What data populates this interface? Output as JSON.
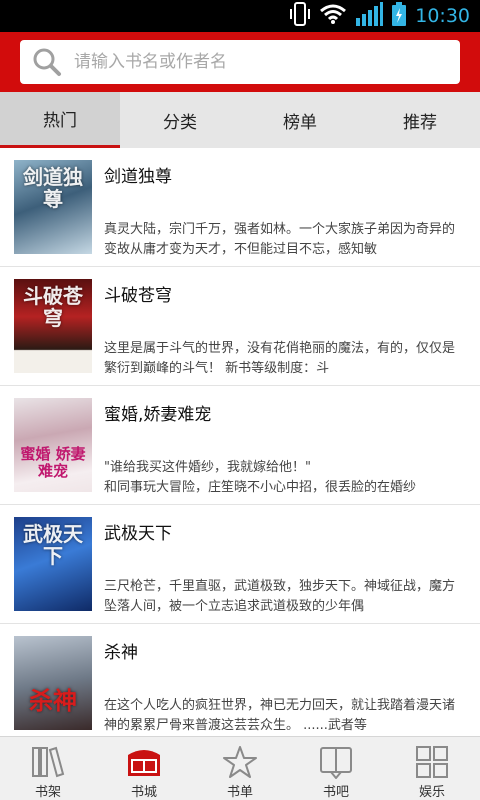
{
  "status": {
    "time": "10:30",
    "time_color": "#33b5e5"
  },
  "search": {
    "placeholder": "请输入书名或作者名",
    "bar_color": "#d20c0c"
  },
  "tabs": [
    {
      "label": "热门",
      "active": true
    },
    {
      "label": "分类",
      "active": false
    },
    {
      "label": "榜单",
      "active": false
    },
    {
      "label": "推荐",
      "active": false
    }
  ],
  "books": [
    {
      "title": "剑道独尊",
      "cover_text": "剑道独尊",
      "desc": "真灵大陆，宗门千万，强者如林。一个大家族子弟因为奇异的变故从庸才变为天才，不但能过目不忘，感知敏"
    },
    {
      "title": "斗破苍穹",
      "cover_text": "斗破苍穹",
      "desc": "这里是属于斗气的世界，没有花俏艳丽的魔法，有的，仅仅是繁衍到巅峰的斗气！ 新书等级制度：斗"
    },
    {
      "title": "蜜婚,娇妻难宠",
      "cover_text": "蜜婚 娇妻难宠",
      "desc": "\"谁给我买这件婚纱，我就嫁给他！\"\n和同事玩大冒险，庄笙晓不小心中招，很丢脸的在婚纱"
    },
    {
      "title": "武极天下",
      "cover_text": "武极天下",
      "desc": "三尺枪芒，千里直驱，武道极致，独步天下。神域征战，魔方坠落人间，被一个立志追求武道极致的少年偶"
    },
    {
      "title": "杀神",
      "cover_text": "杀神",
      "desc": "在这个人吃人的疯狂世界，神已无力回天，就让我踏着漫天诸神的累累尸骨来普渡这芸芸众生。 ......武者等"
    }
  ],
  "nav": {
    "bookshelf": "书架",
    "bookcity": "书城",
    "booklist": "书单",
    "forum": "书吧",
    "entertainment": "娱乐",
    "active_color": "#c91212"
  }
}
